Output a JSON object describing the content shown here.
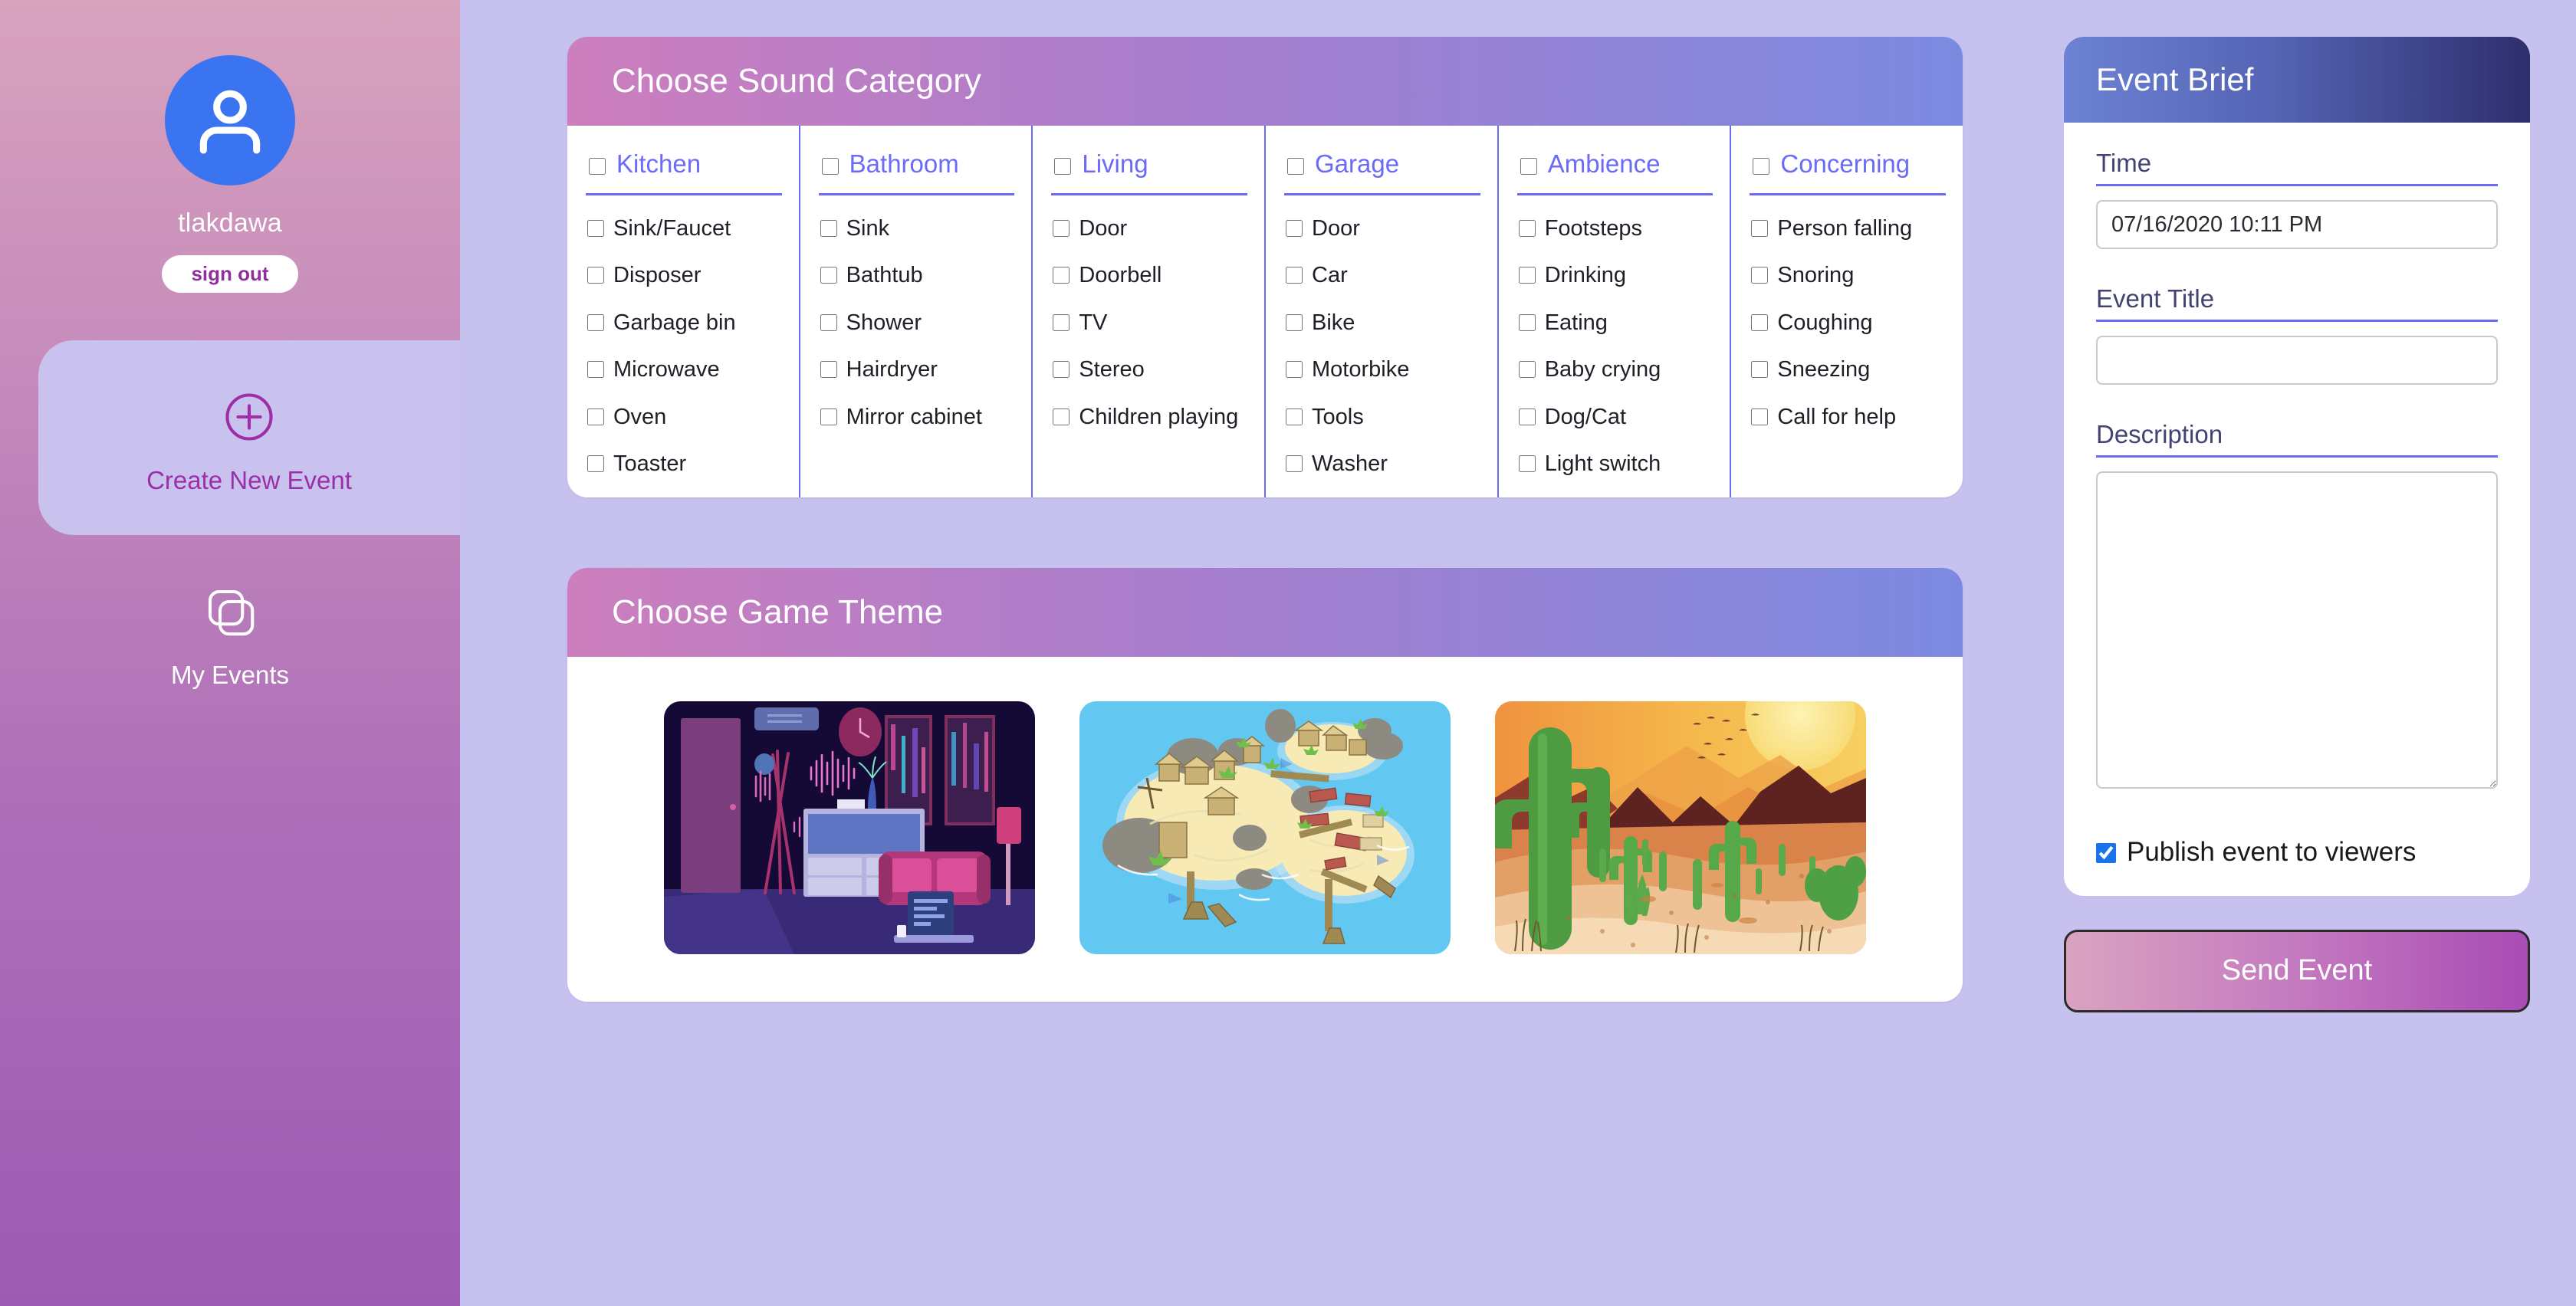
{
  "sidebar": {
    "username": "tlakdawa",
    "sign_out_label": "sign out",
    "avatar_icon": "user-avatar-icon",
    "items": [
      {
        "label": "Create New Event",
        "icon": "plus-circle-icon",
        "active": true
      },
      {
        "label": "My Events",
        "icon": "stacked-squares-icon",
        "active": false
      }
    ]
  },
  "sound_panel": {
    "title": "Choose Sound Category",
    "columns": [
      {
        "label": "Kitchen",
        "checked": false,
        "items": [
          "Sink/Faucet",
          "Disposer",
          "Garbage bin",
          "Microwave",
          "Oven",
          "Toaster"
        ]
      },
      {
        "label": "Bathroom",
        "checked": false,
        "items": [
          "Sink",
          "Bathtub",
          "Shower",
          "Hairdryer",
          "Mirror cabinet"
        ]
      },
      {
        "label": "Living",
        "checked": false,
        "items": [
          "Door",
          "Doorbell",
          "TV",
          "Stereo",
          "Children playing"
        ]
      },
      {
        "label": "Garage",
        "checked": false,
        "items": [
          "Door",
          "Car",
          "Bike",
          "Motorbike",
          "Tools",
          "Washer"
        ]
      },
      {
        "label": "Ambience",
        "checked": false,
        "items": [
          "Footsteps",
          "Drinking",
          "Eating",
          "Baby crying",
          "Dog/Cat",
          "Light switch"
        ]
      },
      {
        "label": "Concerning",
        "checked": false,
        "items": [
          "Person falling",
          "Snoring",
          "Coughing",
          "Sneezing",
          "Call for help"
        ]
      }
    ]
  },
  "theme_panel": {
    "title": "Choose Game Theme",
    "themes": [
      {
        "name": "night-living-room-theme",
        "alt": "Dark living room at night with neon sound waves"
      },
      {
        "name": "island-village-theme",
        "alt": "Tropical island village on blue water"
      },
      {
        "name": "desert-sunset-theme",
        "alt": "Desert with cacti at sunset"
      }
    ]
  },
  "event_brief": {
    "title": "Event Brief",
    "time_label": "Time",
    "time_value": "07/16/2020 10:11 PM",
    "title_label": "Event Title",
    "title_value": "",
    "title_placeholder": "",
    "description_label": "Description",
    "description_value": "",
    "description_placeholder": "",
    "publish_label": "Publish event to viewers",
    "publish_checked": true,
    "send_label": "Send Event"
  },
  "colors": {
    "page_background": "#c6c1ee",
    "sidebar_top": "#d8a3bd",
    "sidebar_bottom": "#9d5bb3",
    "accent_blue": "#6b6bf5",
    "accent_purple": "#9b2fa8",
    "avatar_blue": "#3b74f0",
    "checkbox_blue": "#1a73e8"
  }
}
